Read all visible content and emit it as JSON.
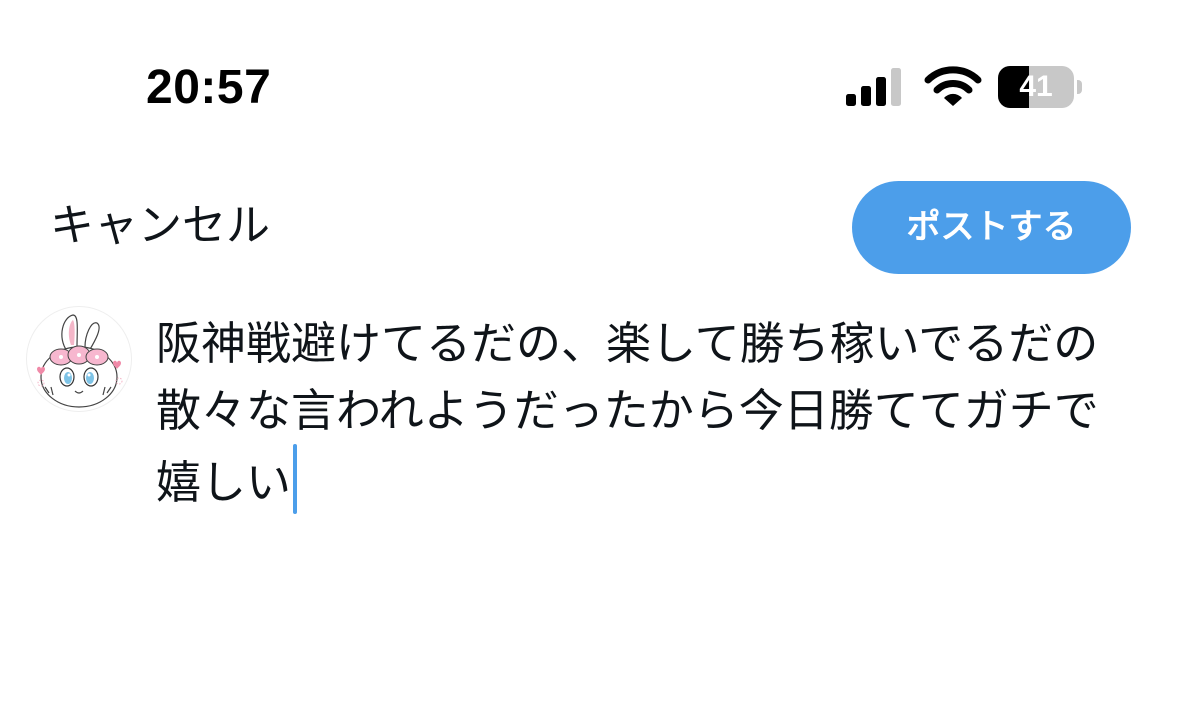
{
  "status_bar": {
    "time": "20:57",
    "signal_icon": "cellular-signal-icon",
    "wifi_icon": "wifi-icon",
    "battery_level": "41",
    "battery_fraction": 0.41
  },
  "header": {
    "cancel_label": "キャンセル",
    "post_label": "ポストする"
  },
  "composer": {
    "avatar_icon": "profile-avatar-icon",
    "text": "阪神戦避けてるだの、楽して勝ち稼いでるだの散々な言われようだったから今日勝ててガチで嬉しい"
  },
  "colors": {
    "accent": "#4c9eea",
    "text": "#0f1419",
    "background": "#ffffff"
  }
}
